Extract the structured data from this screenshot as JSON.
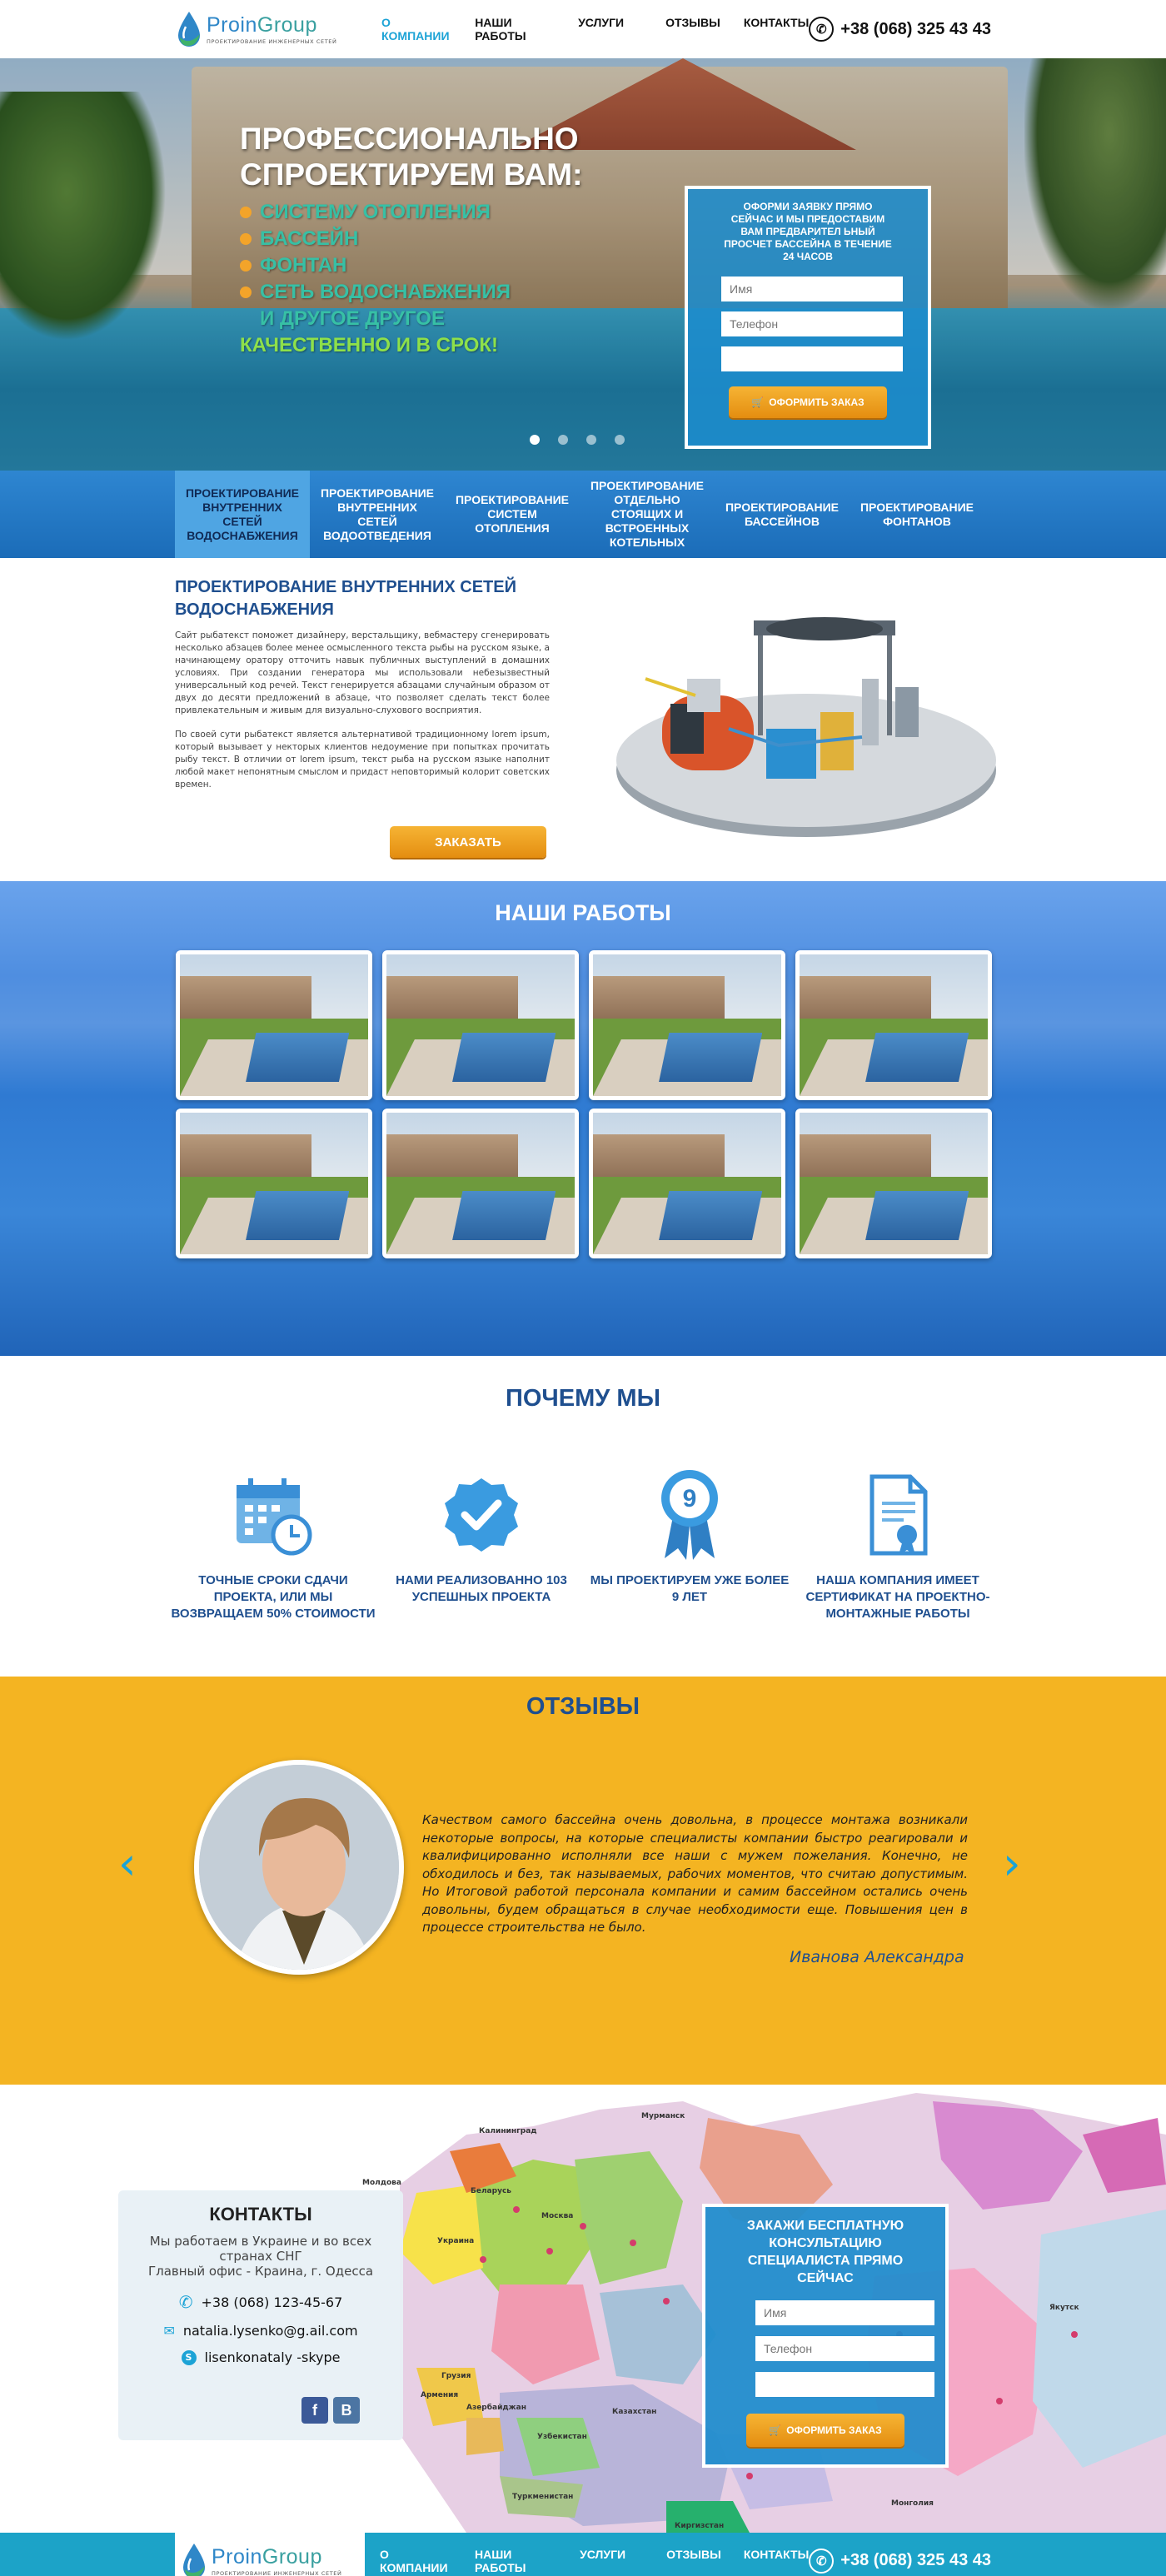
{
  "brand": {
    "name_a": "Proin",
    "name_b": "Group",
    "tagline": "проектирование инженерных сетей"
  },
  "nav": [
    "О компании",
    "Наши работы",
    "Услуги",
    "Отзывы",
    "Контакты"
  ],
  "phone": "+38 (068) 325 43 43",
  "hero": {
    "title_1": "Профессионально",
    "title_2": "спроектируем вам:",
    "items": [
      "Систему отопления",
      "Бассейн",
      "Фонтан",
      "Сеть водоснабжения"
    ],
    "extra": "и другое другое",
    "accent": "Качественно и в срок!",
    "form": {
      "title": "Оформи заявку прямо сейчас и мы предоставим вам предварител ьный просчет бассейна в течение 24 часов",
      "name_placeholder": "Имя",
      "phone_placeholder": "Телефон",
      "button": "Оформить заказ"
    },
    "slides": 4,
    "active_slide": 1
  },
  "services": [
    "Проектирование внутренних сетей водоснабжения",
    "Проектирование внутренних сетей водоотведения",
    "Проектирование систем отопления",
    "Проектирование отдельно стоящих и встроенных котельных",
    "Проектирование бассейнов",
    "Проектирование фонтанов"
  ],
  "about": {
    "title": "Проектирование внутренних сетей водоснабжения",
    "p1": "Сайт рыбатекст поможет дизайнеру, верстальщику, вебмастеру сгенерировать несколько абзацев более менее осмысленного текста рыбы на русском языке, а начинающему оратору отточить навык публичных выступлений в домашних условиях. При создании генератора мы использовали небезызвестный универсальный код речей. Текст генерируется абзацами случайным образом от двух до десяти предложений в абзаце, что позволяет сделать текст более привлекательным и живым для визуально-слухового восприятия.",
    "p2": "По своей сути рыбатекст является альтернативой традиционному lorem ipsum, который вызывает у некторых клиентов недоумение при попытках прочитать рыбу текст. В отличии от lorem ipsum, текст рыба на русском языке наполнит любой макет непонятным смыслом и придаст неповторимый колорит советских времен.",
    "button": "Заказать"
  },
  "works": {
    "title": "Наши работы",
    "count": 8
  },
  "why": {
    "title": "Почему мы",
    "items": [
      {
        "icon": "calendar-clock-icon",
        "label": "Точные сроки сдачи проекта, или мы возвращаем 50% стоимости"
      },
      {
        "icon": "checkmark-badge-icon",
        "label": "Нами реализованно 103 успешных проекта"
      },
      {
        "icon": "award-ribbon-icon",
        "label": "Мы проектируем уже более 9 лет",
        "badge": "9"
      },
      {
        "icon": "certificate-icon",
        "label": "Наша компания имеет сертификат на проектно-монтажные работы"
      }
    ]
  },
  "reviews": {
    "title": "Отзывы",
    "text": "Качеством самого бассейна очень довольна, в процессе монтажа возникали некоторые вопросы, на которые специалисты компании быстро реагировали и квалифицированно исполняли все наши с мужем пожелания. Конечно, не обходилось и без, так называемых, рабочих моментов, что считаю допустимым. Но Итоговой работой персонала компании и самим бассейном остались очень довольны, будем обращаться в случае необходимости еще. Повышения цен в процессе строительства не было.",
    "author": "Иванова Александра"
  },
  "contacts": {
    "title": "Контакты",
    "desc_1": "Мы работаем в Украине и во всех",
    "desc_2": "странах СНГ",
    "desc_3": "Главный офис - Краина, г. Одесса",
    "phone": "+38 (068) 123-45-67",
    "email": "natalia.lysenko@g.ail.com",
    "skype": "lisenkonataly -skype",
    "social": [
      "f",
      "В"
    ],
    "map_labels": [
      "Калининград",
      "Мурманск",
      "Молдова",
      "Украина",
      "Беларусь",
      "Москва",
      "Казахстан",
      "Узбекистан",
      "Туркменистан",
      "Киргизстан",
      "Монголия",
      "Якутск",
      "Армения",
      "Грузия",
      "Азербайджан"
    ],
    "form": {
      "title": "Закажи бесплатную консультацию специалиста прямо сейчас",
      "name_placeholder": "Имя",
      "phone_placeholder": "Телефон",
      "button": "Оформить заказ"
    }
  },
  "footer_nav": [
    "О компании",
    "Наши работы",
    "Услуги",
    "Отзывы",
    "Контакты"
  ],
  "colors": {
    "primary": "#1f4f8f",
    "accent": "#1ca3d6",
    "orange": "#f3a42a",
    "yellow": "#f4b422"
  }
}
